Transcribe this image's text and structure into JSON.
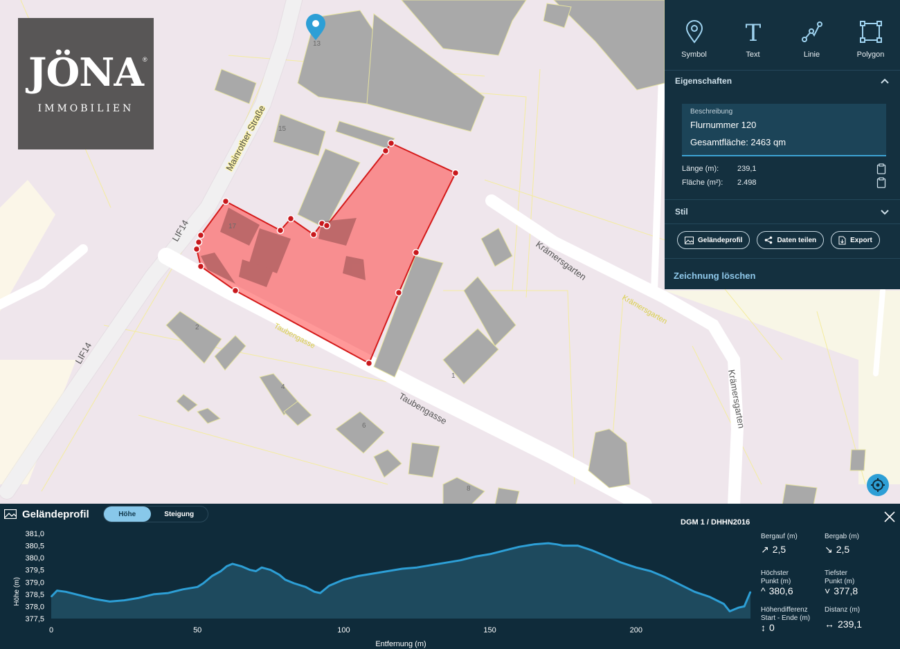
{
  "map": {
    "streets": {
      "mainrother": "Mainrother Straße",
      "lif14_upper": "LIF14",
      "lif14_lower": "LIF14",
      "taubengasse_main": "Taubengasse",
      "taubengasse_yellow": "Taubengasse",
      "kraemersgarten_upper": "Krämersgarten",
      "kraemersgarten_yellow": "Krämersgarten",
      "kraemersgarten_right": "Krämersgarten"
    },
    "house_numbers": [
      "13",
      "15",
      "17",
      "2",
      "4",
      "6",
      "8",
      "1"
    ]
  },
  "logo": {
    "brand": "JÖNA",
    "registered": "®",
    "subtitle": "IMMOBILIEN"
  },
  "panel": {
    "tools": [
      {
        "label": "Symbol",
        "icon": "map-pin-icon"
      },
      {
        "label": "Text",
        "icon": "text-icon"
      },
      {
        "label": "Linie",
        "icon": "line-icon"
      },
      {
        "label": "Polygon",
        "icon": "polygon-icon"
      }
    ],
    "properties_title": "Eigenschaften",
    "description_label": "Beschreibung",
    "description_line1": "Flurnummer 120",
    "description_line2": "Gesamtfläche: 2463 qm",
    "length_label": "Länge (m):",
    "length_value": "239,1",
    "area_label": "Fläche (m²):",
    "area_value": "2.498",
    "style_title": "Stil",
    "buttons": {
      "profile": "Geländeprofil",
      "share": "Daten teilen",
      "export": "Export"
    },
    "delete_label": "Zeichnung löschen",
    "accent": "#3da3d4"
  },
  "profile": {
    "title": "Geländeprofil",
    "toggle_active": "Höhe",
    "toggle_inactive": "Steigung",
    "source": "DGM 1 / DHHN2016",
    "stats": {
      "ascent_label": "Bergauf (m)",
      "ascent_value": "2,5",
      "descent_label": "Bergab (m)",
      "descent_value": "2,5",
      "highest_label_1": "Höchster",
      "highest_label_2": "Punkt (m)",
      "highest_value": "380,6",
      "lowest_label_1": "Tiefster",
      "lowest_label_2": "Punkt (m)",
      "lowest_value": "377,8",
      "diff_label_1": "Höhendifferenz",
      "diff_label_2": "Start - Ende (m)",
      "diff_value": "0",
      "distance_label": "Distanz (m)",
      "distance_value": "239,1"
    }
  },
  "chart_data": {
    "type": "area",
    "xlabel": "Entfernung (m)",
    "ylabel": "Höhe (m)",
    "xlim": [
      0,
      239.1
    ],
    "ylim": [
      377.5,
      381.0
    ],
    "xticks": [
      "0",
      "50",
      "100",
      "150",
      "200"
    ],
    "xtick_values": [
      0,
      50,
      100,
      150,
      200
    ],
    "yticks": [
      "381,0",
      "380,5",
      "380,0",
      "379,5",
      "379,0",
      "378,5",
      "378,0",
      "377,5"
    ],
    "ytick_values": [
      381.0,
      380.5,
      380.0,
      379.5,
      379.0,
      378.5,
      378.0,
      377.5
    ],
    "grid": false,
    "color": "#2d9fd6",
    "x": [
      0,
      2,
      5,
      10,
      15,
      20,
      25,
      30,
      35,
      40,
      45,
      50,
      52,
      55,
      58,
      60,
      62,
      65,
      68,
      70,
      72,
      75,
      78,
      80,
      83,
      87,
      90,
      92,
      95,
      98,
      100,
      105,
      110,
      115,
      120,
      125,
      130,
      135,
      140,
      145,
      150,
      155,
      160,
      165,
      170,
      173,
      175,
      180,
      185,
      190,
      195,
      200,
      205,
      210,
      215,
      220,
      225,
      230,
      232,
      235,
      237,
      239.1
    ],
    "y": [
      378.4,
      378.65,
      378.6,
      378.45,
      378.3,
      378.2,
      378.25,
      378.35,
      378.5,
      378.55,
      378.7,
      378.8,
      378.95,
      379.25,
      379.45,
      379.65,
      379.75,
      379.65,
      379.5,
      379.45,
      379.6,
      379.5,
      379.3,
      379.1,
      378.95,
      378.8,
      378.6,
      378.55,
      378.85,
      379.0,
      379.1,
      379.25,
      379.35,
      379.45,
      379.55,
      379.6,
      379.7,
      379.8,
      379.9,
      380.05,
      380.15,
      380.3,
      380.45,
      380.55,
      380.6,
      380.55,
      380.5,
      380.5,
      380.3,
      380.05,
      379.8,
      379.6,
      379.45,
      379.2,
      378.9,
      378.6,
      378.4,
      378.1,
      377.8,
      377.95,
      378.0,
      378.6
    ]
  }
}
